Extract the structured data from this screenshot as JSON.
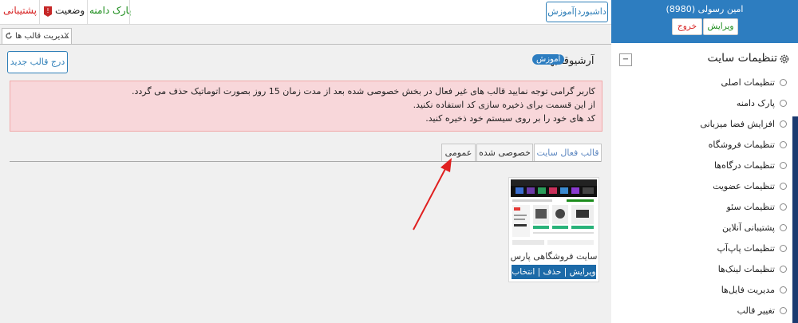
{
  "top_bar": {
    "support_label": "پشتیبانی",
    "status_label": "وضعیت",
    "domain_park_label": "پارک دامنه",
    "dashboard_label": "داشبورد|آموزش"
  },
  "doc_tab": {
    "close_glyph": "X",
    "label": "مدیریت قالب ها"
  },
  "content": {
    "new_template_button": "درج قالب جدید",
    "header_title": "آرشیوقالبها",
    "tutorial_badge": "آموزش",
    "alert_lines": [
      "کاربر گرامی توجه نمایید قالب های غیر فعال در بخش خصوصی شده بعد از مدت زمان 15 روز بصورت اتوماتیک حذف می گردد.",
      "از این قسمت برای ذخیره سازی کد استفاده نکنید.",
      "کد های خود را بر روی سیستم خود ذخیره کنید."
    ],
    "tabs": [
      {
        "label": "قالب فعال سایت"
      },
      {
        "label": "خصوصی شده"
      },
      {
        "label": "عمومی"
      }
    ],
    "card": {
      "title": "سایت فروشگاهی پارس",
      "actions": "ویرایش | حذف | انتخاب"
    }
  },
  "sidebar": {
    "user_name": "امین رسولی (8980)",
    "edit_button": "ویرایش",
    "exit_button": "خروج",
    "title": "تنظیمات سایت",
    "collapse_glyph": "−",
    "items": [
      {
        "label": "تنظیمات اصلی"
      },
      {
        "label": "پارک دامنه"
      },
      {
        "label": "افزایش فضا میزبانی"
      },
      {
        "label": "تنظیمات فروشگاه"
      },
      {
        "label": "تنظیمات درگاه‌ها"
      },
      {
        "label": "تنظیمات عضویت"
      },
      {
        "label": "تنظیمات سئو"
      },
      {
        "label": "پشتیبانی آنلاین"
      },
      {
        "label": "تنظیمات پاپ‌آپ"
      },
      {
        "label": "تنظیمات لینک‌ها"
      },
      {
        "label": "مدیریت فایل‌ها"
      },
      {
        "label": "تغییر قالب"
      }
    ]
  },
  "colors": {
    "accent": "#2d7dc0",
    "alert_bg": "#f8d7da",
    "support_red": "#d62020",
    "park_green": "#1b8c1b"
  }
}
